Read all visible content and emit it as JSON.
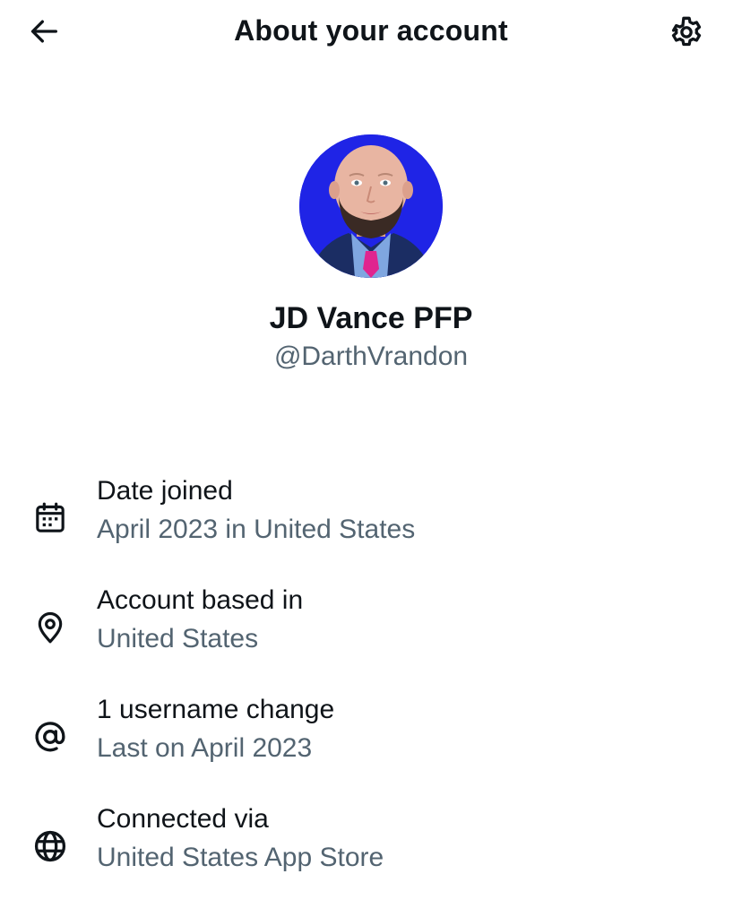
{
  "header": {
    "title": "About your account",
    "back_icon": "arrow-left-icon",
    "settings_icon": "gear-icon"
  },
  "profile": {
    "display_name": "JD Vance PFP",
    "handle": "@DarthVrandon",
    "avatar_background": "#1f24e6"
  },
  "info_rows": [
    {
      "icon": "calendar-icon",
      "title": "Date joined",
      "subtitle": "April 2023 in United States"
    },
    {
      "icon": "location-pin-icon",
      "title": "Account based in",
      "subtitle": "United States"
    },
    {
      "icon": "at-sign-icon",
      "title": "1 username change",
      "subtitle": "Last on April 2023"
    },
    {
      "icon": "globe-icon",
      "title": "Connected via",
      "subtitle": "United States App Store"
    }
  ],
  "colors": {
    "text_primary": "#0f1419",
    "text_secondary": "#536471",
    "background": "#ffffff"
  }
}
